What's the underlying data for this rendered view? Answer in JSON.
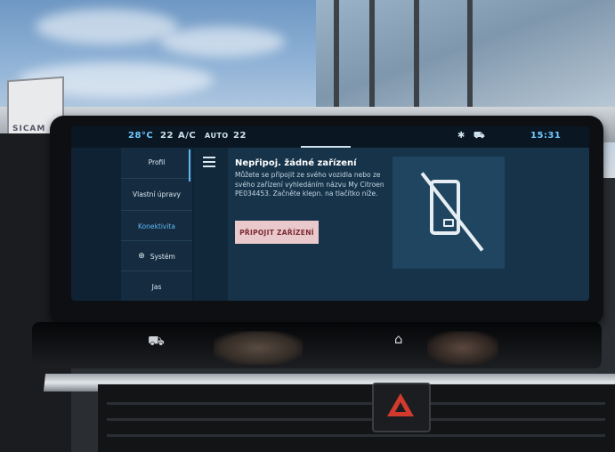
{
  "status_bar": {
    "temperature_left": "28°C",
    "fan_level": "22",
    "ac_label": "A/C",
    "auto_label": "AUTO",
    "temperature_right": "22",
    "bluetooth_icon": "bluetooth-icon",
    "car_icon": "car-icon",
    "time": "15:31"
  },
  "sidebar": {
    "items": [
      {
        "label": "Profil",
        "active": false
      },
      {
        "label": "Vlastní úpravy",
        "active": false
      },
      {
        "label": "Konektivita",
        "active": true
      },
      {
        "label": "Systém",
        "icon": "globe-icon",
        "active": false
      },
      {
        "label": "Jas",
        "active": false
      }
    ]
  },
  "menu": {
    "icon": "hamburger-icon"
  },
  "main": {
    "title": "Nepřipoj. žádné zařízení",
    "description": "Můžete se připojit ze svého vozidla nebo ze svého zařízení vyhledáním názvu My Citroen PE034453. Začněte klepn. na tlačítko níže.",
    "connect_button": "PŘIPOJIT ZAŘÍZENÍ",
    "illustration_icon": "phone-disabled-icon"
  },
  "background": {
    "sign_text": "SICAM"
  },
  "colors": {
    "accent": "#5fb8f0",
    "button_bg": "#e9c9cc",
    "button_text": "#7a2a34",
    "hazard": "#d23a2e"
  }
}
